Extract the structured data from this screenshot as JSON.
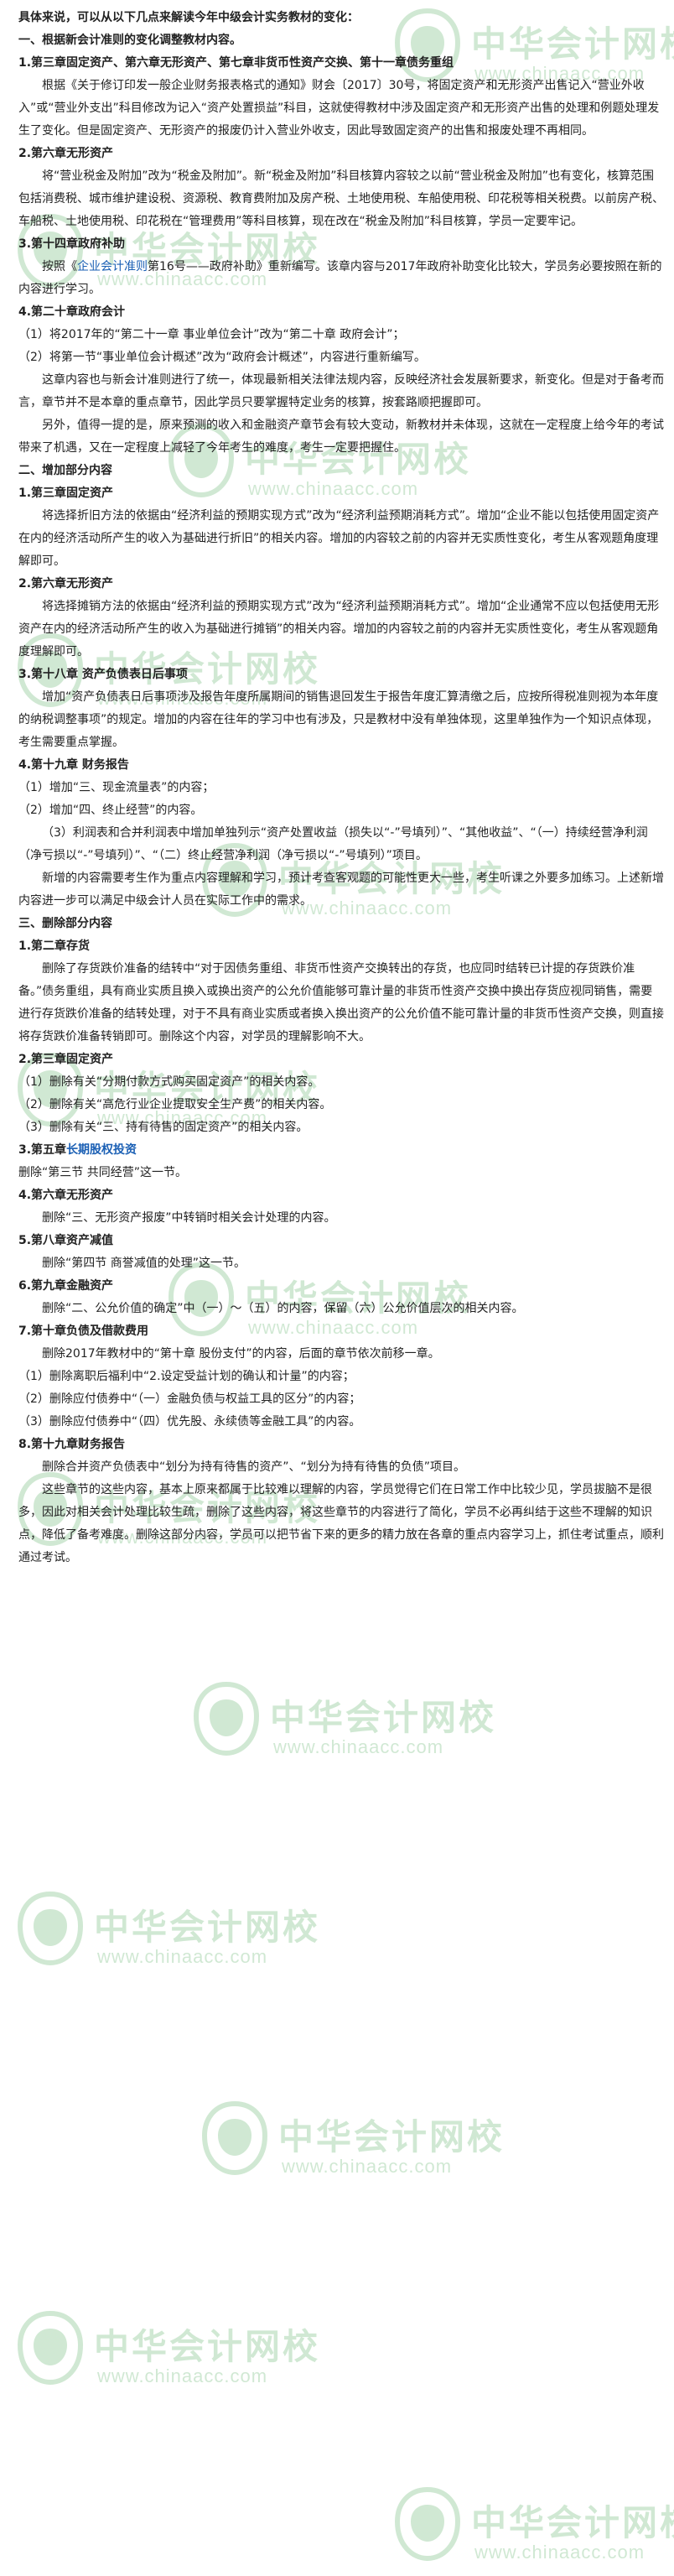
{
  "watermark": {
    "cn": "中华会计网校",
    "url": "www.chinaacc.com",
    "color": "#2d9a3a"
  },
  "colors": {
    "link": "#1a5fb4"
  },
  "blocks": [
    {
      "type": "intro",
      "text": "具体来说，可以从以下几点来解读今年中级会计实务教材的变化："
    },
    {
      "type": "section",
      "text": "一、根据新会计准则的变化调整教材内容。"
    },
    {
      "type": "heading",
      "text": "1.第三章固定资产、第六章无形资产、第七章非货币性资产交换、第十一章债务重组"
    },
    {
      "type": "para",
      "text": "根据《关于修订印发一般企业财务报表格式的通知》财会〔2017〕30号，将固定资产和无形资产出售记入“营业外收入”或“营业外支出”科目修改为记入“资产处置损益”科目，这就使得教材中涉及固定资产和无形资产出售的处理和例题处理发生了变化。但是固定资产、无形资产的报废仍计入营业外收支，因此导致固定资产的出售和报废处理不再相同。"
    },
    {
      "type": "heading",
      "text": "2.第六章无形资产"
    },
    {
      "type": "para",
      "text": "将“营业税金及附加”改为“税金及附加”。新“税金及附加”科目核算内容较之以前“营业税金及附加”也有变化，核算范围包括消费税、城市维护建设税、资源税、教育费附加及房产税、土地使用税、车船使用税、印花税等相关税费。以前房产税、车船税、土地使用税、印花税在“管理费用”等科目核算，现在改在“税金及附加”科目核算，学员一定要牢记。"
    },
    {
      "type": "heading",
      "text": "3.第十四章政府补助"
    },
    {
      "type": "para_link",
      "pre": "按照《",
      "link": "企业会计准则",
      "post": "第16号——政府补助》重新编写。该章内容与2017年政府补助变化比较大，学员务必要按照在新的内容进行学习。"
    },
    {
      "type": "heading",
      "text": "4.第二十章政府会计"
    },
    {
      "type": "item",
      "text": "（1）将2017年的“第二十一章 事业单位会计”改为“第二十章 政府会计”；"
    },
    {
      "type": "item",
      "text": "（2）将第一节“事业单位会计概述”改为“政府会计概述”，内容进行重新编写。"
    },
    {
      "type": "para",
      "text": "这章内容也与新会计准则进行了统一，体现最新相关法律法规内容，反映经济社会发展新要求，新变化。但是对于备考而言，章节并不是本章的重点章节，因此学员只要掌握特定业务的核算，按套路顺把握即可。"
    },
    {
      "type": "para",
      "text": "另外，值得一提的是，原来预测的收入和金融资产章节会有较大变动，新教材并未体现，这就在一定程度上给今年的考试带来了机遇，又在一定程度上减轻了今年考生的难度，考生一定要把握住。"
    },
    {
      "type": "section",
      "text": "二、增加部分内容"
    },
    {
      "type": "heading",
      "text": "1.第三章固定资产"
    },
    {
      "type": "para",
      "text": "将选择折旧方法的依据由“经济利益的预期实现方式”改为“经济利益预期消耗方式”。增加“企业不能以包括使用固定资产在内的经济活动所产生的收入为基础进行折旧”的相关内容。增加的内容较之前的内容并无实质性变化，考生从客观题角度理解即可。"
    },
    {
      "type": "heading",
      "text": "2.第六章无形资产"
    },
    {
      "type": "para",
      "text": "将选择摊销方法的依据由“经济利益的预期实现方式”改为“经济利益预期消耗方式”。增加“企业通常不应以包括使用无形资产在内的经济活动所产生的收入为基础进行摊销”的相关内容。增加的内容较之前的内容并无实质性变化，考生从客观题角度理解即可。"
    },
    {
      "type": "heading",
      "text": "3.第十八章 资产负债表日后事项"
    },
    {
      "type": "para",
      "text": "增加“资产负债表日后事项涉及报告年度所属期间的销售退回发生于报告年度汇算清缴之后，应按所得税准则视为本年度的纳税调整事项”的规定。增加的内容在往年的学习中也有涉及，只是教材中没有单独体现，这里单独作为一个知识点体现，考生需要重点掌握。"
    },
    {
      "type": "heading",
      "text": "4.第十九章 财务报告"
    },
    {
      "type": "item",
      "text": "（1）增加“三、现金流量表”的内容；"
    },
    {
      "type": "item",
      "text": "（2）增加“四、终止经营”的内容。"
    },
    {
      "type": "para",
      "text": "（3）利润表和合并利润表中增加单独列示“资产处置收益（损失以“-”号填列）”、“其他收益”、“（一）持续经营净利润（净亏损以“-”号填列）”、“（二）终止经营净利润（净亏损以“-”号填列）”项目。"
    },
    {
      "type": "para",
      "text": "新增的内容需要考生作为重点内容理解和学习，预计考查客观题的可能性更大一些，考生听课之外要多加练习。上述新增内容进一步可以满足中级会计人员在实际工作中的需求。"
    },
    {
      "type": "section",
      "text": "三、删除部分内容"
    },
    {
      "type": "heading",
      "text": "1.第二章存货"
    },
    {
      "type": "para",
      "text": "删除了存货跌价准备的结转中“对于因债务重组、非货币性资产交换转出的存货，也应同时结转已计提的存货跌价准备。”债务重组，具有商业实质且换入或换出资产的公允价值能够可靠计量的非货币性资产交换中换出存货应视同销售，需要进行存货跌价准备的结转处理，对于不具有商业实质或者换入换出资产的公允价值不能可靠计量的非货币性资产交换，则直接将存货跌价准备转销即可。删除这个内容，对学员的理解影响不大。"
    },
    {
      "type": "heading",
      "text": "2.第三章固定资产"
    },
    {
      "type": "item",
      "text": "（1）删除有关“分期付款方式购买固定资产”的相关内容。"
    },
    {
      "type": "item",
      "text": "（2）删除有关“高危行业企业提取安全生产费”的相关内容。"
    },
    {
      "type": "item",
      "text": "（3）删除有关“三、持有待售的固定资产”的相关内容。"
    },
    {
      "type": "heading_link",
      "pre": "3.第五章",
      "link": "长期股权投资",
      "post": ""
    },
    {
      "type": "item",
      "text": "删除“第三节 共同经营”这一节。"
    },
    {
      "type": "heading",
      "text": "4.第六章无形资产"
    },
    {
      "type": "para",
      "text": "删除“三、无形资产报废”中转销时相关会计处理的内容。"
    },
    {
      "type": "heading",
      "text": "5.第八章资产减值"
    },
    {
      "type": "para",
      "text": "删除“第四节 商誉减值的处理”这一节。"
    },
    {
      "type": "heading",
      "text": "6.第九章金融资产"
    },
    {
      "type": "para",
      "text": "删除“二、公允价值的确定”中（一）～（五）的内容，保留（六）公允价值层次的相关内容。"
    },
    {
      "type": "heading",
      "text": "7.第十章负债及借款费用"
    },
    {
      "type": "para",
      "text": "删除2017年教材中的“第十章 股份支付”的内容，后面的章节依次前移一章。"
    },
    {
      "type": "item",
      "text": "（1）删除离职后福利中“2.设定受益计划的确认和计量”的内容；"
    },
    {
      "type": "item",
      "text": "（2）删除应付债券中“（一）金融负债与权益工具的区分”的内容；"
    },
    {
      "type": "item",
      "text": "（3）删除应付债券中“（四）优先股、永续债等金融工具”的内容。"
    },
    {
      "type": "heading",
      "text": "8.第十九章财务报告"
    },
    {
      "type": "para",
      "text": "删除合并资产负债表中“划分为持有待售的资产”、“划分为持有待售的负债”项目。"
    },
    {
      "type": "para",
      "text": "这些章节的这些内容，基本上原来都属于比较难以理解的内容，学员觉得它们在日常工作中比较少见，学员拔脑不是很多，因此对相关会计处理比较生疏，删除了这些内容，将这些章节的内容进行了简化，学员不必再纠结于这些不理解的知识点，降低了备考难度。删除这部分内容，学员可以把节省下来的更多的精力放在各章的重点内容学习上，抓住考试重点，顺利通过考试。"
    }
  ]
}
